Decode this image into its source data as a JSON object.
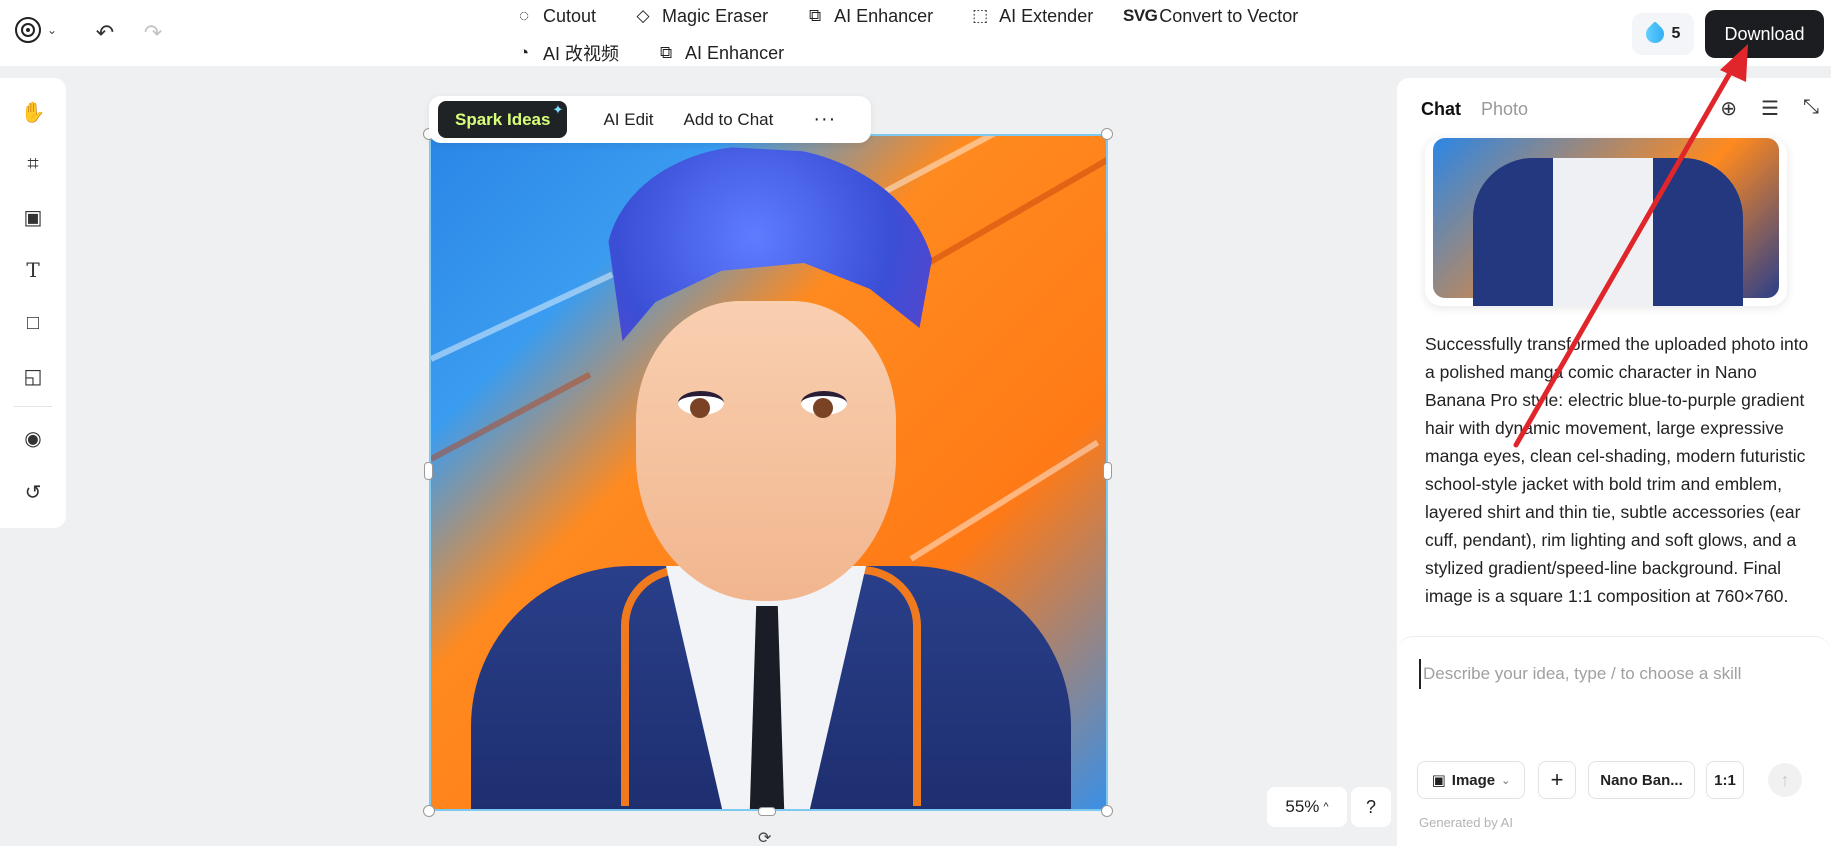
{
  "header": {
    "logo_icon": "logo-icon",
    "undo_icon": "undo-icon",
    "redo_icon": "redo-icon",
    "tools_row1": [
      {
        "label": "Cutout",
        "icon": "cutout-icon"
      },
      {
        "label": "Magic Eraser",
        "icon": "eraser-icon"
      },
      {
        "label": "AI Enhancer",
        "icon": "enhance-icon"
      },
      {
        "label": "AI Extender",
        "icon": "extend-icon"
      },
      {
        "label": "Convert to Vector",
        "icon": "svg-icon"
      }
    ],
    "tools_row2": [
      {
        "label": "AI 改视频",
        "icon": "video-icon"
      },
      {
        "label": "AI Enhancer",
        "icon": "enhance-icon"
      }
    ],
    "credits": "5",
    "download_label": "Download"
  },
  "left_toolbar": {
    "items": [
      {
        "name": "hand-tool",
        "icon": "hand-icon"
      },
      {
        "name": "crop-tool",
        "icon": "crop-icon"
      },
      {
        "name": "image-tool",
        "icon": "image-icon"
      },
      {
        "name": "text-tool",
        "icon": "text-icon"
      },
      {
        "name": "shape-tool",
        "icon": "square-icon"
      },
      {
        "name": "sticker-tool",
        "icon": "sticky-note-icon"
      },
      {
        "name": "avatar-tool",
        "icon": "user-circle-icon"
      },
      {
        "name": "history-tool",
        "icon": "history-icon"
      }
    ]
  },
  "floatbar": {
    "spark_label": "Spark Ideas",
    "ai_edit": "AI Edit",
    "add_to_chat": "Add to Chat",
    "more": "···"
  },
  "zoom": {
    "level": "55%",
    "help": "?"
  },
  "panel": {
    "tabs": [
      "Chat",
      "Photo"
    ],
    "message": "Successfully transformed the uploaded photo into a polished manga comic character in Nano Banana Pro style: electric blue-to-purple gradient hair with dynamic movement, large expressive manga eyes, clean cel-shading, modern futuristic school-style jacket with bold trim and emblem, layered shirt and thin tie, subtle accessories (ear cuff, pendant), rim lighting and soft glows, and a stylized gradient/speed-line background. Final image is a square 1:1 composition at 760×760.",
    "composer": {
      "placeholder": "Describe your idea, type / to choose a skill",
      "value": "",
      "image_chip": "Image",
      "model_chip": "Nano Ban...",
      "ratio_chip": "1:1",
      "footer": "Generated by AI"
    }
  },
  "colors": {
    "download_bg": "#1c1d20",
    "spark_text": "#d8ff7a",
    "arrow": "#e0262b",
    "selection_border": "#7ec9ef"
  }
}
